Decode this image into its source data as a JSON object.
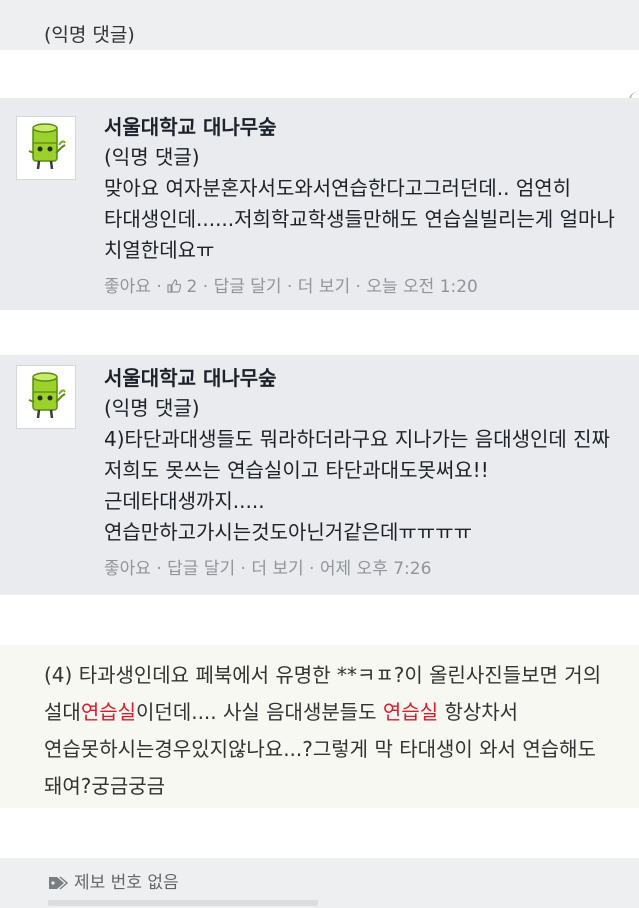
{
  "top": {
    "label": "(익명 댓글)"
  },
  "comments": [
    {
      "author": "서울대학교 대나무숲",
      "subtitle": "(익명 댓글)",
      "text": "맞아요 여자분혼자서도와서연습한다고그러던데.. 엄연히 타대생인데......저희학교학생들만해도 연습실빌리는게 얼마나 치열한데요ㅠ",
      "like": "좋아요",
      "like_count": "2",
      "reply": "답글 달기",
      "more": "더 보기",
      "time": "오늘 오전 1:20",
      "avatar_icon": "bamboo-mascot-icon"
    },
    {
      "author": "서울대학교 대나무숲",
      "subtitle": "(익명 댓글)",
      "text": "4)타단과대생들도 뭐라하더라구요 지나가는 음대생인데 진짜 저희도 못쓰는 연습실이고 타단과대도못써요!!근데타대생까지.....연습만하고가시는것도아닌거같은데ㅠㅠㅠㅠ",
      "like": "좋아요",
      "reply": "답글 달기",
      "more": "더 보기",
      "time": "어제 오후 7:26",
      "avatar_icon": "bamboo-mascot-icon"
    }
  ],
  "quote": {
    "part1": "(4) 타과생인데요 페북에서 유명한 **ㅋㅍ?이 올린사진들보면 거의 설대",
    "highlight1": "연습실",
    "part2": "이던데.... 사실 음대생분들도 ",
    "highlight2": "연습실",
    "part3": " 항상차서 연습못하시는경우있지않나요...?그렇게 막 타대생이 와서 연습해도 돼여?궁금궁금",
    "highlight_color": "#e0192a"
  },
  "footer": {
    "tag_label": "제보 번호 없음",
    "tag_icon": "tag-icon"
  }
}
